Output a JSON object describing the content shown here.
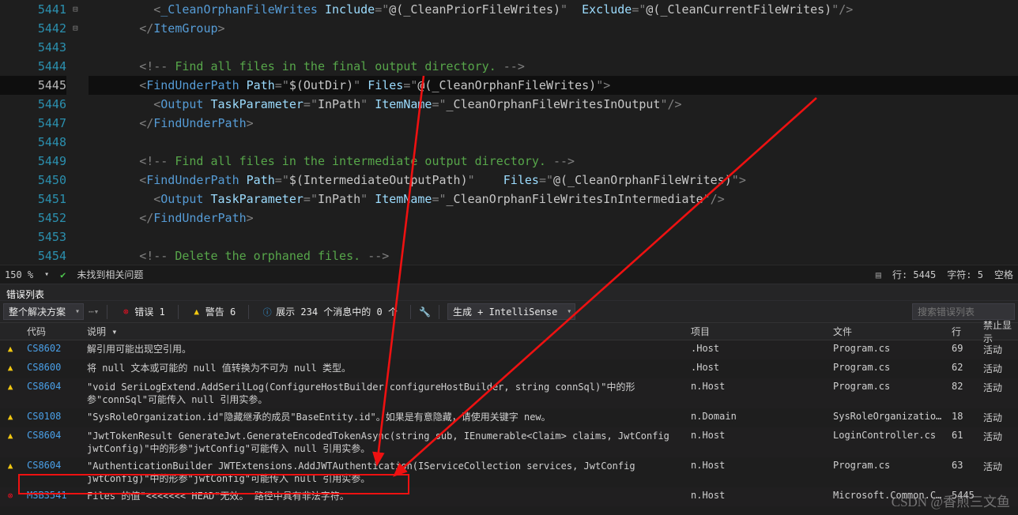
{
  "code_lines": [
    {
      "n": 5441,
      "fold": "",
      "html": "        <span class='p'>&lt;</span><span class='t'>_CleanOrphanFileWrites</span> <span class='at'>Include</span><span class='p'>=</span><span class='p'>\"</span><span class='av'>@(_CleanPriorFileWrites)</span><span class='p'>\"</span>  <span class='at'>Exclude</span><span class='p'>=</span><span class='p'>\"</span><span class='av'>@(_CleanCurrentFileWrites)</span><span class='p'>\"</span><span class='p'>/&gt;</span>"
    },
    {
      "n": 5442,
      "fold": "",
      "html": "      <span class='p'>&lt;/</span><span class='t'>ItemGroup</span><span class='p'>&gt;</span>"
    },
    {
      "n": 5443,
      "fold": "",
      "html": ""
    },
    {
      "n": 5444,
      "fold": "",
      "html": "      <span class='p'>&lt;!--</span><span class='c'> Find all files in the final output directory. </span><span class='p'>--&gt;</span>"
    },
    {
      "n": 5445,
      "fold": "⊟",
      "cur": true,
      "html": "      <span class='p'>&lt;</span><span class='t'>FindUnderPath</span> <span class='at'>Path</span><span class='p'>=</span><span class='p'>\"</span><span class='av'>$(OutDir)</span><span class='p'>\"</span> <span class='at'>Files</span><span class='p'>=</span><span class='p'>\"</span><span class='av'>@(_CleanOrphanFileWrites)</span><span class='p'>\"</span><span class='p'>&gt;</span>"
    },
    {
      "n": 5446,
      "fold": "",
      "html": "        <span class='p'>&lt;</span><span class='t'>Output</span> <span class='at'>TaskParameter</span><span class='p'>=</span><span class='p'>\"</span><span class='av'>InPath</span><span class='p'>\"</span> <span class='at'>ItemName</span><span class='p'>=</span><span class='p'>\"</span><span class='av'>_CleanOrphanFileWritesInOutput</span><span class='p'>\"</span><span class='p'>/&gt;</span>"
    },
    {
      "n": 5447,
      "fold": "",
      "html": "      <span class='p'>&lt;/</span><span class='t'>FindUnderPath</span><span class='p'>&gt;</span>"
    },
    {
      "n": 5448,
      "fold": "",
      "html": ""
    },
    {
      "n": 5449,
      "fold": "",
      "html": "      <span class='p'>&lt;!--</span><span class='c'> Find all files in the intermediate output directory. </span><span class='p'>--&gt;</span>"
    },
    {
      "n": 5450,
      "fold": "⊟",
      "html": "      <span class='p'>&lt;</span><span class='t'>FindUnderPath</span> <span class='at'>Path</span><span class='p'>=</span><span class='p'>\"</span><span class='av'>$(IntermediateOutputPath)</span><span class='p'>\"</span>    <span class='at'>Files</span><span class='p'>=</span><span class='p'>\"</span><span class='av'>@(_CleanOrphanFileWrites)</span><span class='p'>\"</span><span class='p'>&gt;</span>"
    },
    {
      "n": 5451,
      "fold": "",
      "html": "        <span class='p'>&lt;</span><span class='t'>Output</span> <span class='at'>TaskParameter</span><span class='p'>=</span><span class='p'>\"</span><span class='av'>InPath</span><span class='p'>\"</span> <span class='at'>ItemName</span><span class='p'>=</span><span class='p'>\"</span><span class='av'>_CleanOrphanFileWritesInIntermediate</span><span class='p'>\"</span><span class='p'>/&gt;</span>"
    },
    {
      "n": 5452,
      "fold": "",
      "html": "      <span class='p'>&lt;/</span><span class='t'>FindUnderPath</span><span class='p'>&gt;</span>"
    },
    {
      "n": 5453,
      "fold": "",
      "html": ""
    },
    {
      "n": 5454,
      "fold": "",
      "html": "      <span class='p'>&lt;!--</span><span class='c'> Delete the orphaned files. </span><span class='p'>--&gt;</span>"
    }
  ],
  "status": {
    "zoom": "150 %",
    "heath": "未找到相关问题",
    "line": "行: 5445",
    "col": "字符: 5",
    "spc": "空格"
  },
  "panel_title": "错误列表",
  "filters": {
    "scope": "整个解决方案",
    "errors": "错误 1",
    "warnings": "警告 6",
    "messages": "展示 234 个消息中的 0 个",
    "build": "生成 + IntelliSense",
    "search_placeholder": "搜索错误列表"
  },
  "columns": {
    "c1": "",
    "c2": "代码",
    "c3": "说明 ▾",
    "c4": "项目",
    "c5": "文件",
    "c6": "行",
    "c7": "禁止显示"
  },
  "rows": [
    {
      "ic": "warn",
      "code": "CS8602",
      "desc": "解引用可能出现空引用。",
      "proj": ".Host",
      "file": "Program.cs",
      "line": "69",
      "sup": "活动"
    },
    {
      "ic": "warn",
      "code": "CS8600",
      "desc": "将 null 文本或可能的 null 值转换为不可为 null 类型。",
      "proj": ".Host",
      "file": "Program.cs",
      "line": "62",
      "sup": "活动"
    },
    {
      "ic": "warn",
      "code": "CS8604",
      "desc": "\"void SeriLogExtend.AddSerilLog(ConfigureHostBuilder configureHostBuilder, string connSql)\"中的形参\"connSql\"可能传入 null 引用实参。",
      "proj": "n.Host",
      "file": "Program.cs",
      "line": "82",
      "sup": "活动"
    },
    {
      "ic": "warn",
      "code": "CS0108",
      "desc": "\"SysRoleOrganization.id\"隐藏继承的成员\"BaseEntity.id\"。如果是有意隐藏，请使用关键字 new。",
      "proj": "n.Domain",
      "file": "SysRoleOrganization.cs",
      "line": "18",
      "sup": "活动"
    },
    {
      "ic": "warn",
      "code": "CS8604",
      "desc": "\"JwtTokenResult GenerateJwt.GenerateEncodedTokenAsync(string sub, IEnumerable<Claim> claims, JwtConfig jwtConfig)\"中的形参\"jwtConfig\"可能传入 null 引用实参。",
      "proj": "n.Host",
      "file": "LoginController.cs",
      "line": "61",
      "sup": "活动"
    },
    {
      "ic": "warn",
      "code": "CS8604",
      "desc": "\"AuthenticationBuilder JWTExtensions.AddJWTAuthentication(IServiceCollection services, JwtConfig jwtConfig)\"中的形参\"jwtConfig\"可能传入 null 引用实参。",
      "proj": "n.Host",
      "file": "Program.cs",
      "line": "63",
      "sup": "活动"
    },
    {
      "ic": "err",
      "code": "MSB3541",
      "desc": "Files 的值\"<<<<<<< HEAD\"无效。 路径中具有非法字符。",
      "proj": "n.Host",
      "file": "Microsoft.Common.Cur...",
      "line": "5445",
      "sup": ""
    }
  ],
  "watermark": "CSDN @香煎三文鱼"
}
